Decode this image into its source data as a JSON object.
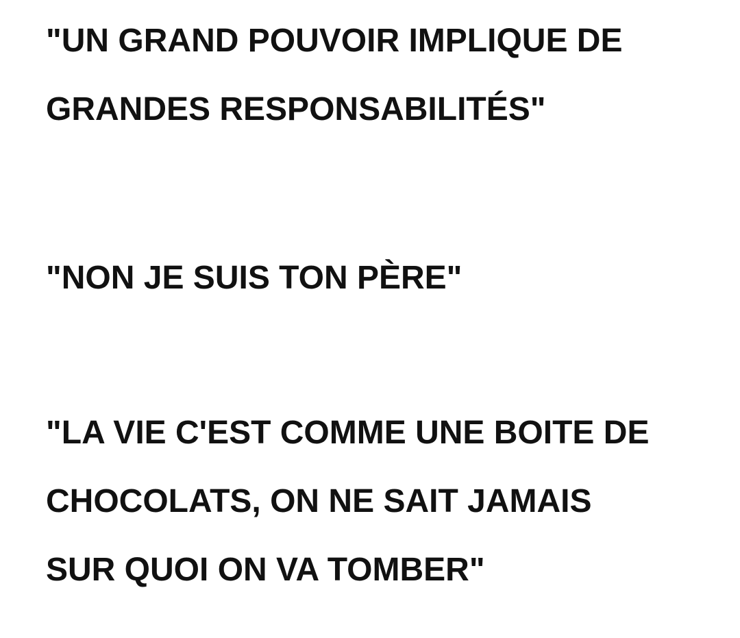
{
  "quotes": [
    {
      "lines": [
        "\"UN GRAND POUVOIR IMPLIQUE DE",
        "GRANDES RESPONSABILITÉS\""
      ]
    },
    {
      "lines": [
        "\"NON JE SUIS TON PÈRE\""
      ]
    },
    {
      "lines": [
        "\"LA VIE C'EST COMME UNE BOITE DE",
        "CHOCOLATS, ON NE SAIT JAMAIS",
        "SUR QUOI ON VA TOMBER\""
      ]
    }
  ]
}
